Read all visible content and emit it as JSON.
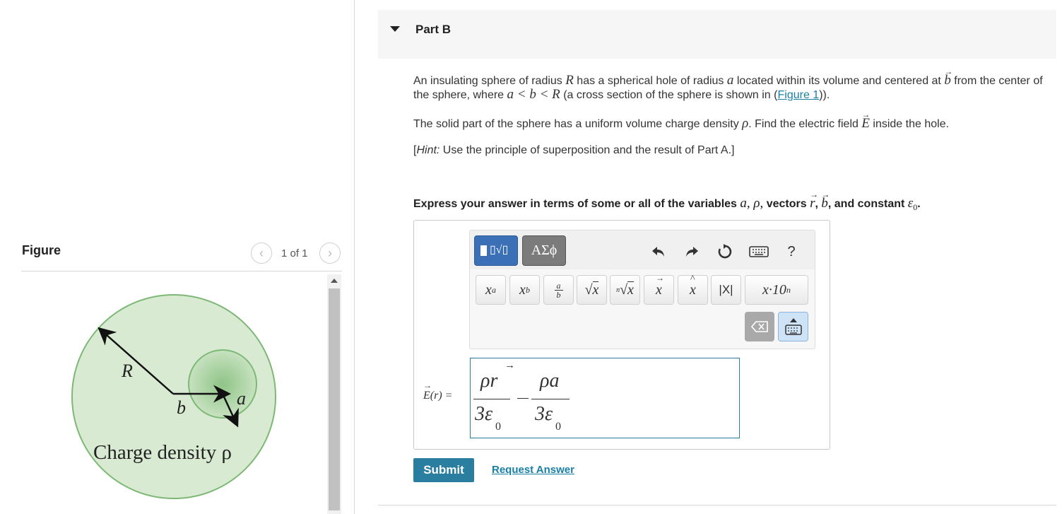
{
  "figure_panel": {
    "title": "Figure",
    "counter": "1 of 1",
    "prev_icon": "chevron-left-icon",
    "next_icon": "chevron-right-icon",
    "labels": {
      "R": "R",
      "b": "b",
      "a": "a",
      "caption": "Charge density ρ"
    }
  },
  "part": {
    "title": "Part B"
  },
  "problem": {
    "p1a_1": "An insulating sphere of radius ",
    "R": "R",
    "p1a_2": " has a spherical hole of radius ",
    "a": "a",
    "p1a_3": " located within its volume and centered at ",
    "b": "b",
    "p1a_4": " from the center of",
    "p1b_1": "the sphere, where ",
    "p1b_ineq": "a < b < R",
    "p1b_2": " (a cross section of the sphere is shown in (",
    "figure_link": "Figure 1",
    "p1b_3": ")).",
    "p2_1": "The solid part of the sphere has a uniform volume charge density ",
    "rho": "ρ",
    "p2_2": ". Find the  electric field ",
    "E": "E",
    "p2_3": " inside the hole.",
    "hint_label": "Hint:",
    "hint_text": " Use the principle of superposition and the result of Part A.]",
    "hint_open": "[",
    "instr_1": "Express your answer in terms of some or all of the variables ",
    "instr_vars": "a, ρ,",
    "instr_2": " vectors ",
    "instr_r": "r",
    "instr_comma": ", ",
    "instr_b": "b",
    "instr_3": ", and  constant ",
    "instr_eps": "ε",
    "instr_eps_sub": "0",
    "instr_end": "."
  },
  "toolbar": {
    "template_icon": "templates-icon",
    "greek_label": "ΑΣϕ",
    "undo_icon": "undo-icon",
    "redo_icon": "redo-icon",
    "reset_icon": "reset-icon",
    "keyboard_icon": "keyboard-icon",
    "help_label": "?",
    "symbols": {
      "power": "xa",
      "subscript": "xb",
      "fraction": "a/b",
      "sqrt": "√x",
      "nroot": "ⁿ√x",
      "vector": "x⃗",
      "hat": "x̂",
      "abs": "|X|",
      "sci": "x·10n"
    }
  },
  "answer": {
    "label": "E(r) =",
    "numerator1": "ρr",
    "denominator1": "3ε",
    "sub1": "0",
    "minus": "−",
    "numerator2": "ρa",
    "denominator2": "3ε",
    "sub2": "0"
  },
  "actions": {
    "submit": "Submit",
    "request_answer": "Request Answer"
  },
  "colors": {
    "accent": "#2a7fa0",
    "sphere_fill": "#d9ead3",
    "sphere_stroke": "#7db875",
    "template_btn": "#3b6fb6"
  }
}
